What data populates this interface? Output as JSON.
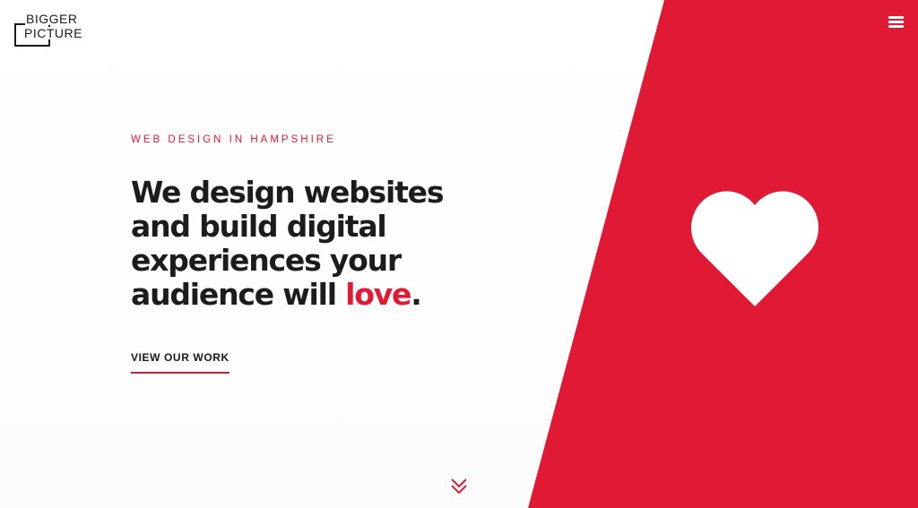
{
  "logo": {
    "line1": "BIGGER",
    "line2": "PICTURE"
  },
  "header": {
    "menu_icon": "hamburger-menu-icon"
  },
  "hero": {
    "eyebrow": "WEB DESIGN IN HAMPSHIRE",
    "headline_line1": "We design websites",
    "headline_line2": "and build digital",
    "headline_line3": "experiences your",
    "headline_line4_prefix": "audience will ",
    "headline_accent": "love",
    "headline_suffix": ".",
    "cta_label": "VIEW OUR WORK",
    "scroll_icon": "chevron-double-down-icon"
  },
  "visual": {
    "heart_icon": "heart-icon"
  },
  "colors": {
    "accent": "#e01935",
    "text": "#1c1c1c",
    "background": "#ffffff"
  }
}
